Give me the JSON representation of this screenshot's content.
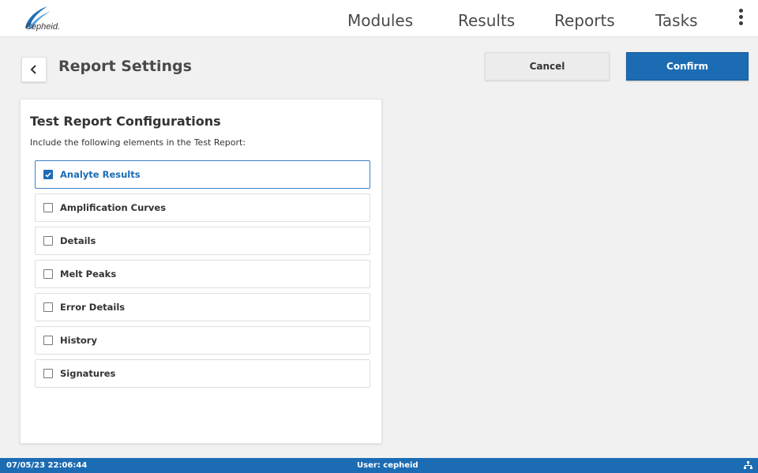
{
  "app": {
    "logo_text": "Cepheid."
  },
  "nav": {
    "items": [
      {
        "label": "Modules"
      },
      {
        "label": "Results"
      },
      {
        "label": "Reports"
      },
      {
        "label": "Tasks"
      }
    ],
    "menu_icon": "kebab-menu-icon"
  },
  "header": {
    "back_icon": "chevron-left-icon",
    "title": "Report Settings",
    "cancel_label": "Cancel",
    "confirm_label": "Confirm"
  },
  "panel": {
    "title": "Test Report Configurations",
    "subtitle": "Include the following elements in the Test Report:",
    "options": [
      {
        "label": "Analyte Results",
        "checked": true
      },
      {
        "label": "Amplification Curves",
        "checked": false
      },
      {
        "label": "Details",
        "checked": false
      },
      {
        "label": "Melt Peaks",
        "checked": false
      },
      {
        "label": "Error Details",
        "checked": false
      },
      {
        "label": "History",
        "checked": false
      },
      {
        "label": "Signatures",
        "checked": false
      }
    ]
  },
  "status": {
    "datetime": "07/05/23 22:06:44",
    "user": "User: cepheid",
    "network_icon": "network-icon"
  },
  "colors": {
    "accent": "#1c6cb3",
    "background": "#f1f1f1"
  }
}
